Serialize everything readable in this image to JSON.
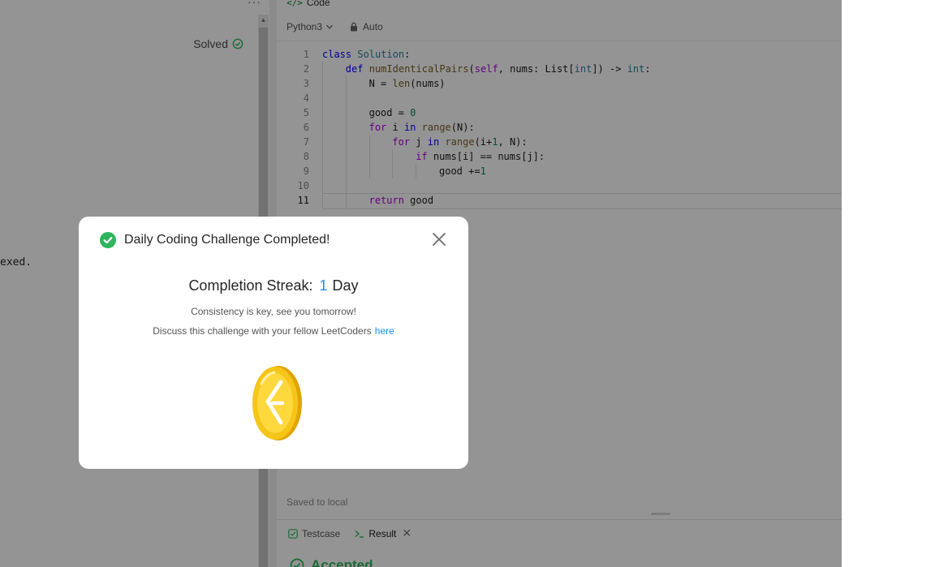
{
  "left_panel": {
    "menu_glyph": "···",
    "solved_label": "Solved",
    "partial_text": "exed."
  },
  "code_panel": {
    "tab_icon": "</>",
    "tab_label": "Code",
    "language": "Python3",
    "auto_label": "Auto",
    "saved_label": "Saved to local",
    "active_line": 11,
    "lines": [
      {
        "n": "1",
        "indent": 0,
        "tokens": [
          [
            "kw",
            "class"
          ],
          [
            "op",
            " "
          ],
          [
            "cls",
            "Solution"
          ],
          [
            "op",
            ":"
          ]
        ]
      },
      {
        "n": "2",
        "indent": 1,
        "tokens": [
          [
            "kw",
            "def"
          ],
          [
            "op",
            " "
          ],
          [
            "fn",
            "numIdenticalPairs"
          ],
          [
            "op",
            "("
          ],
          [
            "kw2",
            "self"
          ],
          [
            "op",
            ", "
          ],
          [
            "op",
            "nums: "
          ],
          [
            "op",
            "List"
          ],
          [
            "op",
            "["
          ],
          [
            "cls",
            "int"
          ],
          [
            "op",
            "]) -> "
          ],
          [
            "cls",
            "int"
          ],
          [
            "op",
            ":"
          ]
        ]
      },
      {
        "n": "3",
        "indent": 2,
        "tokens": [
          [
            "op",
            "N = "
          ],
          [
            "fn",
            "len"
          ],
          [
            "op",
            "(nums)"
          ]
        ]
      },
      {
        "n": "4",
        "indent": 2,
        "tokens": []
      },
      {
        "n": "5",
        "indent": 2,
        "tokens": [
          [
            "op",
            "good = "
          ],
          [
            "num",
            "0"
          ]
        ]
      },
      {
        "n": "6",
        "indent": 2,
        "tokens": [
          [
            "kw2",
            "for"
          ],
          [
            "op",
            " i "
          ],
          [
            "kw",
            "in"
          ],
          [
            "op",
            " "
          ],
          [
            "fn",
            "range"
          ],
          [
            "op",
            "(N):"
          ]
        ]
      },
      {
        "n": "7",
        "indent": 3,
        "tokens": [
          [
            "kw2",
            "for"
          ],
          [
            "op",
            " j "
          ],
          [
            "kw",
            "in"
          ],
          [
            "op",
            " "
          ],
          [
            "fn",
            "range"
          ],
          [
            "op",
            "(i+"
          ],
          [
            "num",
            "1"
          ],
          [
            "op",
            ", N):"
          ]
        ]
      },
      {
        "n": "8",
        "indent": 4,
        "tokens": [
          [
            "kw2",
            "if"
          ],
          [
            "op",
            " nums[i] == nums[j]:"
          ]
        ]
      },
      {
        "n": "9",
        "indent": 5,
        "tokens": [
          [
            "op",
            "good +="
          ],
          [
            "num",
            "1"
          ]
        ]
      },
      {
        "n": "10",
        "indent": 2,
        "tokens": []
      },
      {
        "n": "11",
        "indent": 2,
        "tokens": [
          [
            "kw2",
            "return"
          ],
          [
            "op",
            " good"
          ]
        ]
      }
    ]
  },
  "bottom_panel": {
    "testcase_label": "Testcase",
    "result_label": "Result",
    "result_close": "✕",
    "status_label": "Accepted"
  },
  "modal": {
    "title": "Daily Coding Challenge Completed!",
    "streak_label": "Completion Streak:",
    "streak_value": "1",
    "streak_unit": "Day",
    "message": "Consistency is key, see you tomorrow!",
    "discuss_text": "Discuss this challenge with your fellow LeetCoders",
    "discuss_link": "here"
  },
  "colors": {
    "accent_green": "#2db55d",
    "link_blue": "#1a90ff",
    "coin_gold": "#f5c518"
  }
}
